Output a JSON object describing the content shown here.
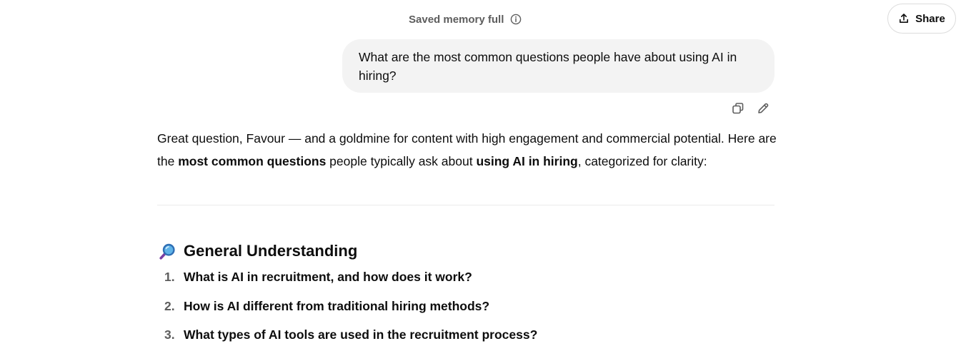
{
  "header": {
    "status_text": "Saved memory full",
    "share_label": "Share"
  },
  "user_message": {
    "text": "What are the most common questions people have about using AI in hiring?"
  },
  "assistant": {
    "intro_part1": "Great question, Favour — and a goldmine for content with high engagement and commercial potential. Here are the ",
    "intro_bold1": "most common questions",
    "intro_part2": " people typically ask about ",
    "intro_bold2": "using AI in hiring",
    "intro_part3": ", categorized for clarity:",
    "section": {
      "emoji": "magnifier-icon",
      "title": "General Understanding",
      "items": [
        {
          "num": "1.",
          "text": "What is AI in recruitment, and how does it work?"
        },
        {
          "num": "2.",
          "text": "How is AI different from traditional hiring methods?"
        },
        {
          "num": "3.",
          "text": "What types of AI tools are used in the recruitment process?"
        }
      ]
    }
  },
  "colors": {
    "bubble_bg": "#f3f3f3",
    "text": "#0d0d0d",
    "muted": "#5d5d5d",
    "border": "#dcdcdc"
  }
}
